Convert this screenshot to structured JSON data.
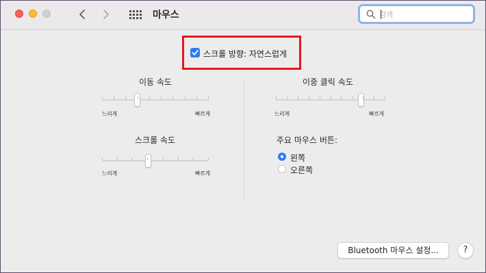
{
  "window": {
    "title": "마우스",
    "traffic_lights": {
      "close": "#fd5f57",
      "minimize": "#febc2e",
      "zoom": "#d0cfd0"
    }
  },
  "toolbar": {
    "back_icon": "chevron-left-icon",
    "forward_icon": "chevron-right-icon",
    "grid_icon": "show-all-grid-icon",
    "search": {
      "placeholder": "검색",
      "value": "",
      "icon": "magnifier-icon"
    }
  },
  "natural_scroll": {
    "label": "스크롤 방향: 자연스럽게",
    "checked": true,
    "highlight_color": "#e8141b"
  },
  "tracking_speed": {
    "title": "이동 속도",
    "min_label": "느리게",
    "max_label": "빠르게",
    "value": 0.33,
    "ticks": 10
  },
  "scroll_speed": {
    "title": "스크롤 속도",
    "min_label": "느리게",
    "max_label": "빠르게",
    "value": 0.43,
    "ticks": 8
  },
  "double_click_speed": {
    "title": "이중 클릭 속도",
    "min_label": "느리게",
    "max_label": "빠르게",
    "value": 0.78,
    "ticks": 11
  },
  "primary_button": {
    "title": "주요 마우스 버튼:",
    "options": [
      {
        "label": "왼쪽",
        "selected": true
      },
      {
        "label": "오른쪽",
        "selected": false
      }
    ]
  },
  "footer": {
    "bluetooth_button": "Bluetooth 마우스 설정...",
    "help_button": "?"
  },
  "colors": {
    "accent": "#2f7bf5",
    "search_focus_ring": "#8fb3e6"
  }
}
